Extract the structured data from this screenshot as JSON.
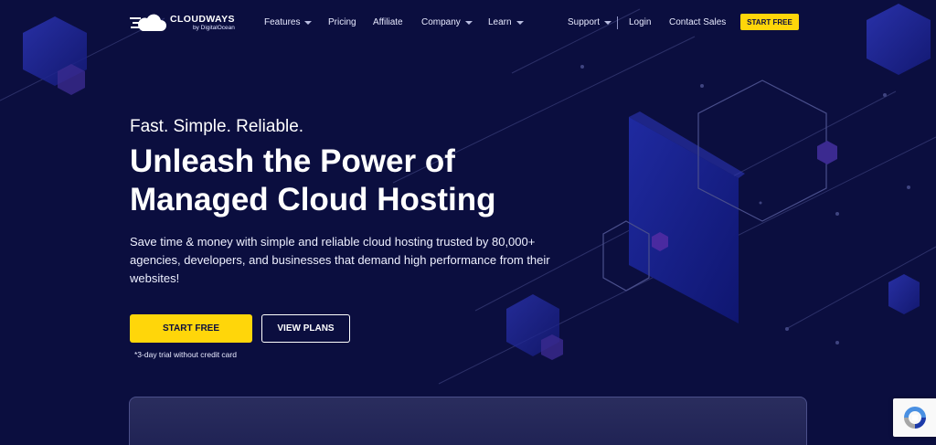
{
  "brand": {
    "name": "CLOUDWAYS",
    "byline": "by DigitalOcean"
  },
  "nav": {
    "items": [
      {
        "label": "Features",
        "dropdown": true
      },
      {
        "label": "Pricing",
        "dropdown": false
      },
      {
        "label": "Affiliate",
        "dropdown": false
      },
      {
        "label": "Company",
        "dropdown": true
      },
      {
        "label": "Learn",
        "dropdown": true
      }
    ],
    "right": [
      {
        "label": "Support",
        "dropdown": true
      },
      {
        "label": "Login",
        "dropdown": false
      },
      {
        "label": "Contact Sales",
        "dropdown": false
      }
    ],
    "cta": "START FREE"
  },
  "hero": {
    "tagline": "Fast. Simple. Reliable.",
    "headline_line1": "Unleash the Power of",
    "headline_line2": "Managed Cloud Hosting",
    "description": "Save time & money with simple and reliable cloud hosting trusted by 80,000+ agencies, developers, and businesses that demand high performance from their websites!",
    "primary_button": "START FREE",
    "secondary_button": "VIEW PLANS",
    "trial_note": "*3-day trial without credit card"
  },
  "colors": {
    "background": "#0b0e3f",
    "accent": "#ffd60a",
    "hex_blue": "#2a32a8"
  },
  "icons": [
    "cloud-logo-icon",
    "caret-down-icon",
    "recaptcha-icon"
  ]
}
